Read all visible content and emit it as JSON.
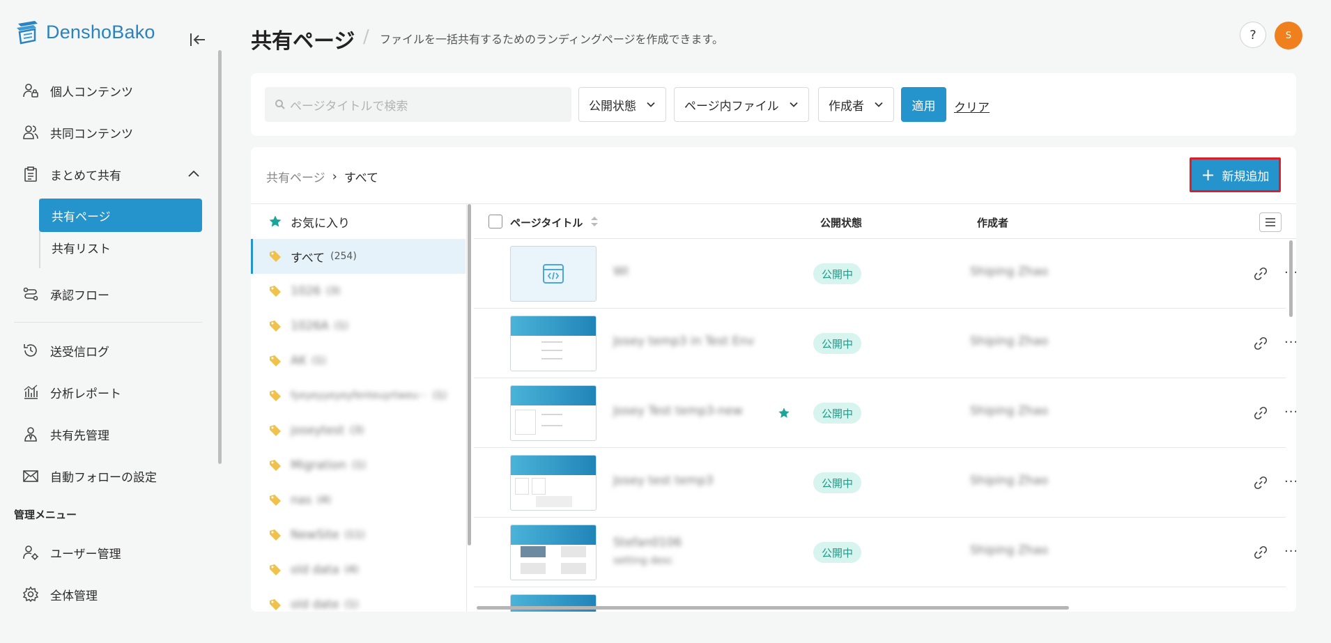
{
  "app": {
    "name": "DenshoBako"
  },
  "sidebar": {
    "items": [
      {
        "label": "個人コンテンツ"
      },
      {
        "label": "共同コンテンツ"
      },
      {
        "label": "まとめて共有"
      },
      {
        "label": "承認フロー"
      },
      {
        "label": "送受信ログ"
      },
      {
        "label": "分析レポート"
      },
      {
        "label": "共有先管理"
      },
      {
        "label": "自動フォローの設定"
      }
    ],
    "sub_items": [
      {
        "label": "共有ページ"
      },
      {
        "label": "共有リスト"
      }
    ],
    "admin_section": "管理メニュー",
    "admin_items": [
      {
        "label": "ユーザー管理"
      },
      {
        "label": "全体管理"
      }
    ]
  },
  "header": {
    "title": "共有ページ",
    "separator": "/",
    "description": "ファイルを一括共有するためのランディングページを作成できます。",
    "help": "?",
    "avatar_initial": "S"
  },
  "filters": {
    "search_placeholder": "ページタイトルで検索",
    "status": "公開状態",
    "files": "ページ内ファイル",
    "author": "作成者",
    "apply": "適用",
    "clear": "クリア"
  },
  "breadcrumb": {
    "root": "共有ページ",
    "sep": "›",
    "current": "すべて"
  },
  "add_button": {
    "label": "新規追加",
    "plus": "+"
  },
  "categories": [
    {
      "name": "お気に入り",
      "count": ""
    },
    {
      "name": "すべて",
      "count": "(254)"
    },
    {
      "name": "1026",
      "count": "(3)"
    },
    {
      "name": "1026A",
      "count": "(1)"
    },
    {
      "name": "AK",
      "count": "(1)"
    },
    {
      "name": "fyeyeyyeyeyfenteuyrtweu···",
      "count": "(1)"
    },
    {
      "name": "joseytest",
      "count": "(3)"
    },
    {
      "name": "Migration",
      "count": "(1)"
    },
    {
      "name": "nas",
      "count": "(4)"
    },
    {
      "name": "NewSite",
      "count": "(11)"
    },
    {
      "name": "old data",
      "count": "(4)"
    },
    {
      "name": "old date",
      "count": "(1)"
    }
  ],
  "table": {
    "headers": {
      "title": "ページタイトル",
      "status": "公開状態",
      "author": "作成者"
    },
    "rows": [
      {
        "title": "WI",
        "subtitle": "",
        "status": "公開中",
        "author": "Shiping Zhao",
        "favorite": false
      },
      {
        "title": "Josey temp3 in Test Env",
        "subtitle": "",
        "status": "公開中",
        "author": "Shiping Zhao",
        "favorite": false
      },
      {
        "title": "Josey Test temp3-new",
        "subtitle": "",
        "status": "公開中",
        "author": "Shiping Zhao",
        "favorite": true
      },
      {
        "title": "Josey test temp3",
        "subtitle": "",
        "status": "公開中",
        "author": "Shiping Zhao",
        "favorite": false
      },
      {
        "title": "Stefan0106",
        "subtitle": "setting desc",
        "status": "公開中",
        "author": "Shiping Zhao",
        "favorite": false
      }
    ]
  },
  "colors": {
    "primary": "#2593cc",
    "badge_bg": "#d7f4ef",
    "badge_text": "#1b9c8b",
    "avatar": "#f07f1e",
    "highlight": "#d9202a"
  }
}
